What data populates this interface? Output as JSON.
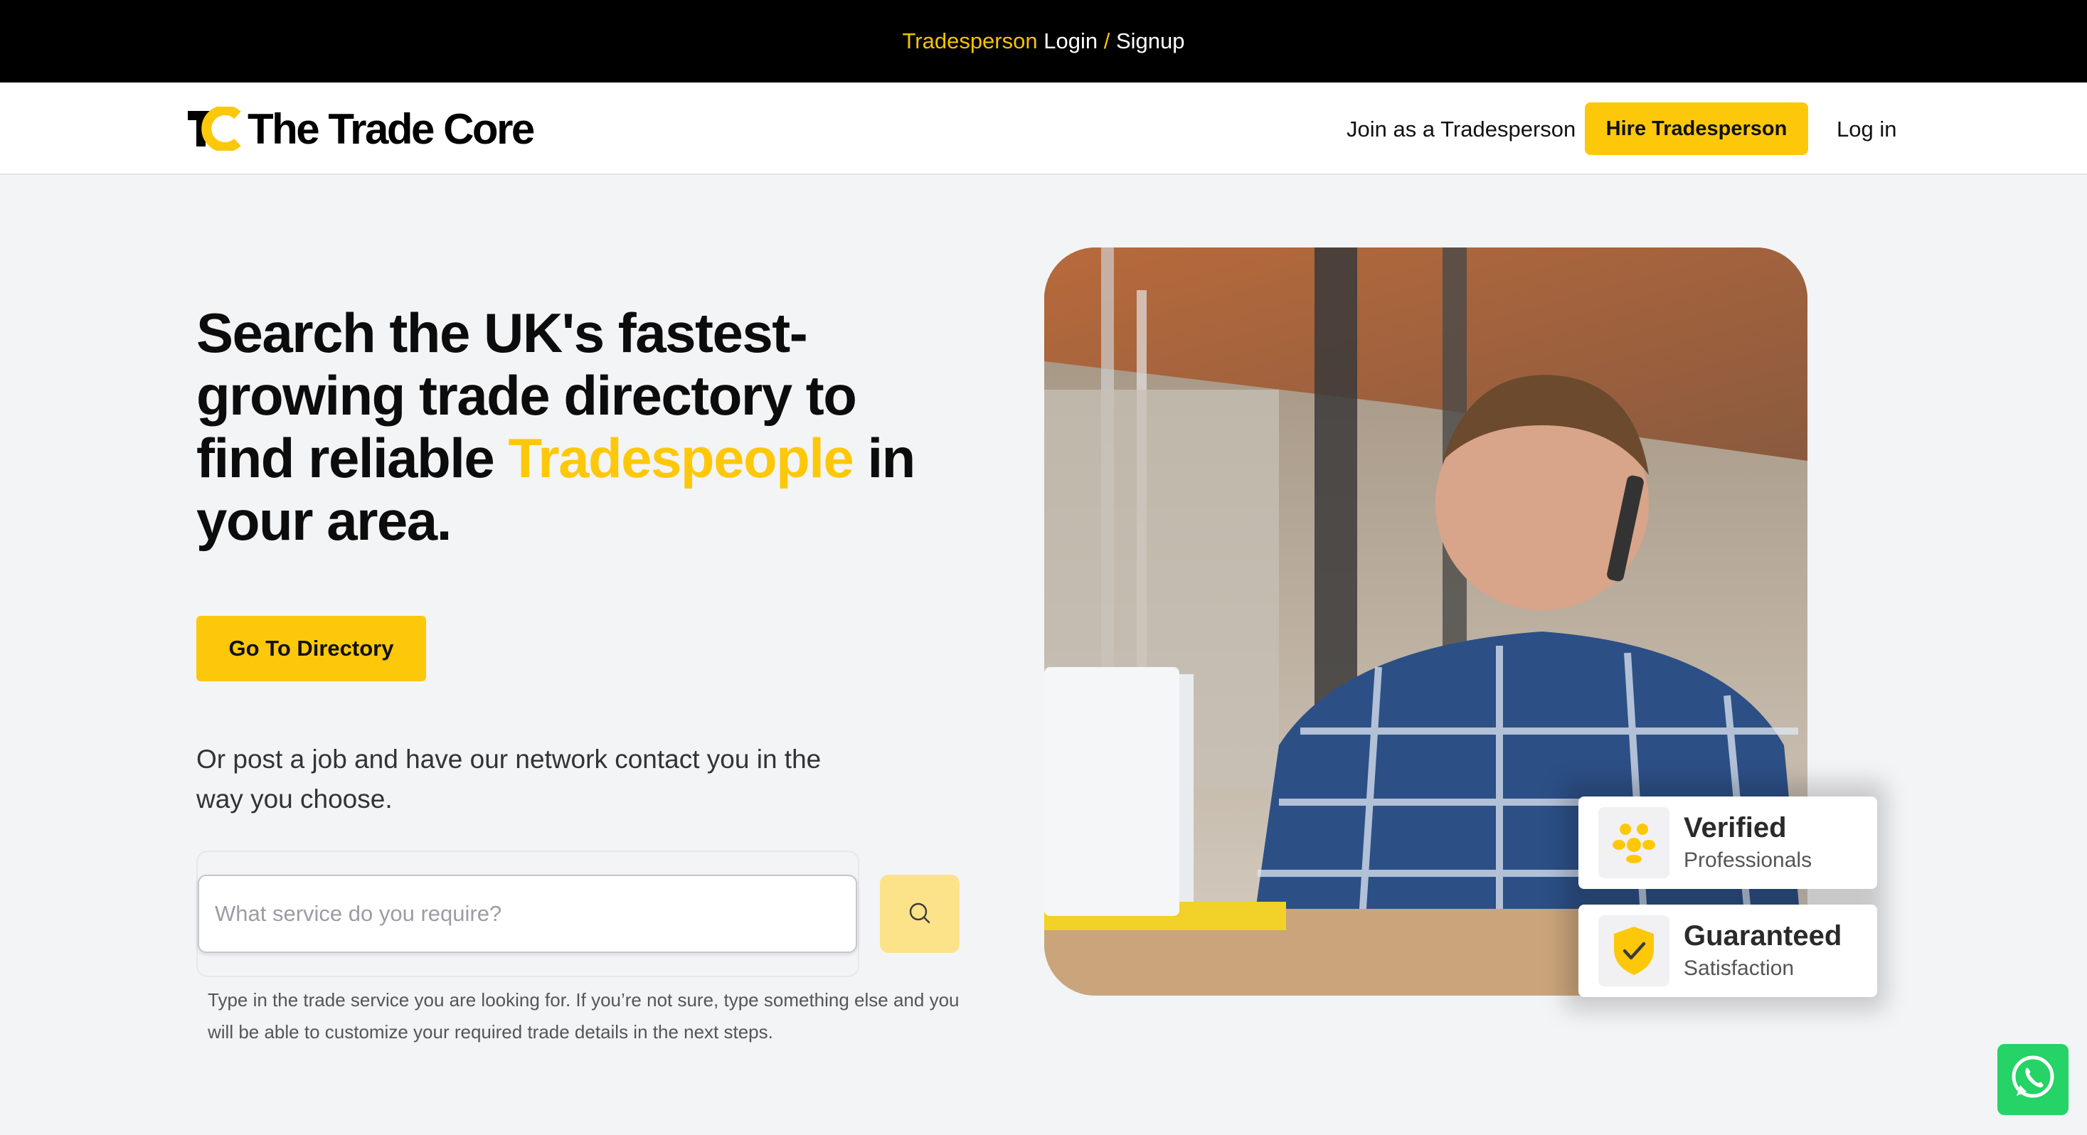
{
  "topbar": {
    "tradesperson": "Tradesperson",
    "login": "Login",
    "separator": "/",
    "signup": "Signup"
  },
  "header": {
    "logo_text": "The Trade Core",
    "nav": {
      "join": "Join as a Tradesperson",
      "hire": "Hire Tradesperson",
      "login": "Log in"
    }
  },
  "hero": {
    "headline_before": "Search the UK's fastest-growing trade directory to find reliable ",
    "headline_highlight": "Tradespeople",
    "headline_after": " in your area.",
    "cta": "Go To Directory",
    "subtext": "Or post a job and have our network contact you in the way you choose.",
    "search": {
      "placeholder": "What service do you require?",
      "value": ""
    },
    "helper": "Type in the trade service you are looking for. If you’re not sure, type something else and you will be able to customize your required trade details in the next steps."
  },
  "badges": [
    {
      "title": "Verified",
      "subtitle": "Professionals",
      "icon": "people-group-icon"
    },
    {
      "title": "Guaranteed",
      "subtitle": "Satisfaction",
      "icon": "shield-check-icon"
    }
  ],
  "colors": {
    "accent": "#fec80a",
    "topbar_bg": "#000000",
    "page_bg": "#f3f4f6",
    "whatsapp": "#25d366"
  }
}
